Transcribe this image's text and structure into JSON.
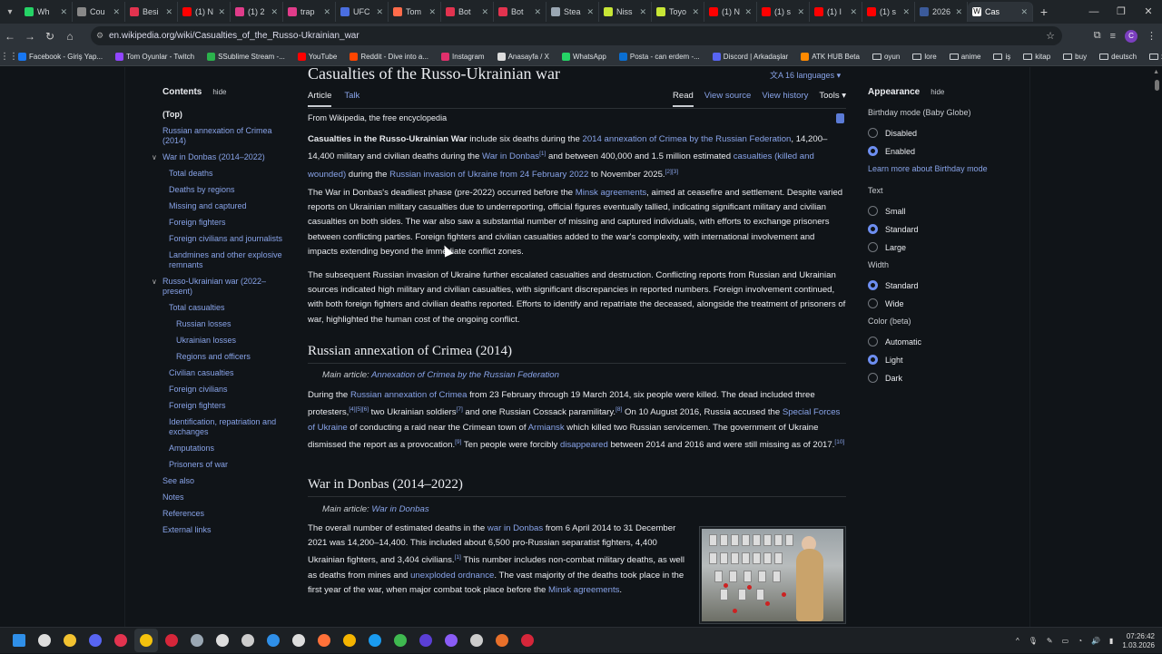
{
  "browser": {
    "tabs": [
      {
        "title": "Wh",
        "color": "#25d366"
      },
      {
        "title": "Cou",
        "color": "#888888"
      },
      {
        "title": "Besi",
        "color": "#e2334f"
      },
      {
        "title": "(1) N",
        "color": "#ff0000"
      },
      {
        "title": "(1) 2",
        "color": "#e03c8a"
      },
      {
        "title": "trap",
        "color": "#e03c8a"
      },
      {
        "title": "UFC",
        "color": "#4a6ee0"
      },
      {
        "title": "Tom",
        "color": "#ff6b4a"
      },
      {
        "title": "Bot",
        "color": "#e2334f"
      },
      {
        "title": "Bot",
        "color": "#e2334f"
      },
      {
        "title": "Stea",
        "color": "#9aa7b3"
      },
      {
        "title": "Niss",
        "color": "#c8e636"
      },
      {
        "title": "Toyo",
        "color": "#c8e636"
      },
      {
        "title": "(1) N",
        "color": "#ff0000"
      },
      {
        "title": "(1) s",
        "color": "#ff0000"
      },
      {
        "title": "(1) I",
        "color": "#ff0000"
      },
      {
        "title": "(1) s",
        "color": "#ff0000"
      },
      {
        "title": "2026",
        "color": "#3b5a9a"
      }
    ],
    "active_tab": {
      "title": "Cas",
      "icon": "wikipedia-icon"
    },
    "url": "en.wikipedia.org/wiki/Casualties_of_the_Russo-Ukrainian_war",
    "profile_initial": "C",
    "bookmarks": [
      {
        "label": "Facebook - Giriş Yap...",
        "color": "#1877f2"
      },
      {
        "label": "Tom Oyunlar - Twitch",
        "color": "#9146ff"
      },
      {
        "label": "SSublime Stream -...",
        "color": "#2bb24c"
      },
      {
        "label": "YouTube",
        "color": "#ff0000"
      },
      {
        "label": "Reddit - Dive into a...",
        "color": "#ff4500"
      },
      {
        "label": "Instagram",
        "color": "#e1306c"
      },
      {
        "label": "Anasayfa / X",
        "color": "#dddddd"
      },
      {
        "label": "WhatsApp",
        "color": "#25d366"
      },
      {
        "label": "Posta - can erdem -...",
        "color": "#0a6ed1"
      },
      {
        "label": "Discord | Arkadaşlar",
        "color": "#5865f2"
      },
      {
        "label": "ATK HUB Beta",
        "color": "#ff8a00"
      }
    ],
    "bookmark_folders": [
      "oyun",
      "lore",
      "anime",
      "iş",
      "kitap",
      "buy",
      "deutsch",
      "x"
    ]
  },
  "toc": {
    "title": "Contents",
    "hide": "hide",
    "items": [
      {
        "label": "(Top)",
        "level": "top"
      },
      {
        "label": "Russian annexation of Crimea (2014)",
        "level": 1
      },
      {
        "label": "War in Donbas (2014–2022)",
        "level": 1,
        "expanded": true
      },
      {
        "label": "Total deaths",
        "level": 2
      },
      {
        "label": "Deaths by regions",
        "level": 2
      },
      {
        "label": "Missing and captured",
        "level": 2
      },
      {
        "label": "Foreign fighters",
        "level": 2
      },
      {
        "label": "Foreign civilians and journalists",
        "level": 2
      },
      {
        "label": "Landmines and other explosive remnants",
        "level": 2
      },
      {
        "label": "Russo-Ukrainian war (2022–present)",
        "level": 1,
        "expanded": true
      },
      {
        "label": "Total casualties",
        "level": 2
      },
      {
        "label": "Russian losses",
        "level": 3
      },
      {
        "label": "Ukrainian losses",
        "level": 3
      },
      {
        "label": "Regions and officers",
        "level": 3
      },
      {
        "label": "Civilian casualties",
        "level": 2
      },
      {
        "label": "Foreign civilians",
        "level": 2
      },
      {
        "label": "Foreign fighters",
        "level": 2
      },
      {
        "label": "Identification, repatriation and exchanges",
        "level": 2
      },
      {
        "label": "Amputations",
        "level": 2
      },
      {
        "label": "Prisoners of war",
        "level": 2
      },
      {
        "label": "See also",
        "level": 1
      },
      {
        "label": "Notes",
        "level": 1
      },
      {
        "label": "References",
        "level": 1
      },
      {
        "label": "External links",
        "level": 1
      }
    ]
  },
  "article": {
    "title": "Casualties of the Russo-Ukrainian war",
    "languages": "16 languages",
    "tab_article": "Article",
    "tab_talk": "Talk",
    "tab_read": "Read",
    "tab_source": "View source",
    "tab_history": "View history",
    "tab_tools": "Tools",
    "from": "From Wikipedia, the free encyclopedia",
    "p1": {
      "bold": "Casualties in the Russo-Ukrainian War",
      "t1": " include six deaths during the ",
      "l1": "2014 annexation of Crimea by the Russian Federation",
      "t2": ", 14,200–14,400 military and civilian deaths during the ",
      "l2": "War in Donbas",
      "s1": "[1]",
      "t3": " and between 400,000 and 1.5 million estimated ",
      "l3": "casualties (killed and wounded)",
      "t4": " during the ",
      "l4": "Russian invasion of Ukraine from 24 February 2022",
      "t5": " to November 2025.",
      "s2": "[2][3]"
    },
    "p2": {
      "t1": "The War in Donbas's deadliest phase (pre-2022) occurred before the ",
      "l1": "Minsk agreements",
      "t2": ", aimed at ceasefire and settlement. Despite varied reports on Ukrainian military casualties due to underreporting, official figures eventually tallied, indicating significant military and civilian casualties on both sides. The war also saw a substantial number of missing and captured individuals, with efforts to exchange prisoners between conflicting parties. Foreign fighters and civilian casualties added to the war's complexity, with international involvement and impacts extending beyond the immediate conflict zones."
    },
    "p3": "The subsequent Russian invasion of Ukraine further escalated casualties and destruction. Conflicting reports from Russian and Ukrainian sources indicated high military and civilian casualties, with significant discrepancies in reported numbers. Foreign involvement continued, with both foreign fighters and civilian deaths reported. Efforts to identify and repatriate the deceased, alongside the treatment of prisoners of war, highlighted the human cost of the ongoing conflict.",
    "h_crimea": "Russian annexation of Crimea (2014)",
    "hat_crimea_label": "Main article: ",
    "hat_crimea_link": "Annexation of Crimea by the Russian Federation",
    "p4": {
      "t1": "During the ",
      "l1": "Russian annexation of Crimea",
      "t2": " from 23 February through 19 March 2014, six people were killed. The dead included three protesters,",
      "s1": "[4][5][6]",
      "t3": " two Ukrainian soldiers",
      "s2": "[7]",
      "t4": " and one Russian Cossack paramilitary.",
      "s3": "[8]",
      "t5": " On 10 August 2016, Russia accused the ",
      "l2": "Special Forces of Ukraine",
      "t6": " of conducting a raid near the Crimean town of ",
      "l3": "Armiansk",
      "t7": " which killed two Russian servicemen. The government of Ukraine dismissed the report as a provocation.",
      "s4": "[9]",
      "t8": " Ten people were forcibly ",
      "l4": "disappeared",
      "t9": " between 2014 and 2016 and were still missing as of 2017.",
      "s5": "[10]"
    },
    "h_donbas": "War in Donbas (2014–2022)",
    "hat_donbas_label": "Main article: ",
    "hat_donbas_link": "War in Donbas",
    "p5": {
      "t1": "The overall number of estimated deaths in the ",
      "l1": "war in Donbas",
      "t2": " from 6 April 2014 to 31 December 2021 was 14,200–14,400. This included about 6,500 pro-Russian separatist fighters, 4,400 Ukrainian fighters, and 3,404 civilians.",
      "s1": "[1]",
      "t3": " This number includes non-combat military deaths, as well as deaths from mines and ",
      "l2": "unexploded ordnance",
      "t4": ". The vast majority of the deaths took place in the first year of the war, when major combat took place before the ",
      "l3": "Minsk agreements",
      "t5": "."
    }
  },
  "appearance": {
    "title": "Appearance",
    "hide": "hide",
    "birthday_label": "Birthday mode (Baby Globe)",
    "birthday_options": [
      {
        "label": "Disabled",
        "on": false
      },
      {
        "label": "Enabled",
        "on": true
      }
    ],
    "learn_more": "Learn more about Birthday mode",
    "text_label": "Text",
    "text_options": [
      {
        "label": "Small",
        "on": false
      },
      {
        "label": "Standard",
        "on": true
      },
      {
        "label": "Large",
        "on": false
      }
    ],
    "width_label": "Width",
    "width_options": [
      {
        "label": "Standard",
        "on": true
      },
      {
        "label": "Wide",
        "on": false
      }
    ],
    "color_label": "Color (beta)",
    "color_options": [
      {
        "label": "Automatic",
        "on": false
      },
      {
        "label": "Light",
        "on": true
      },
      {
        "label": "Dark",
        "on": false
      }
    ]
  },
  "taskbar": {
    "icons": [
      {
        "name": "windows-start-icon",
        "color": "#2f8fe8"
      },
      {
        "name": "search-icon",
        "color": "#dddddd"
      },
      {
        "name": "file-explorer-icon",
        "color": "#f2c230"
      },
      {
        "name": "discord-icon",
        "color": "#5865f2"
      },
      {
        "name": "opera-icon",
        "color": "#e2334f"
      },
      {
        "name": "chrome-icon",
        "color": "#f4c20d"
      },
      {
        "name": "app-red-icon",
        "color": "#d6263a"
      },
      {
        "name": "steam-icon",
        "color": "#9aa7b3"
      },
      {
        "name": "epic-icon",
        "color": "#dddddd"
      },
      {
        "name": "media-icon",
        "color": "#cccccc"
      },
      {
        "name": "edge-icon",
        "color": "#2f8fe8"
      },
      {
        "name": "circle-app-icon",
        "color": "#dddddd"
      },
      {
        "name": "firefox-icon",
        "color": "#ff7139"
      },
      {
        "name": "rockstar-icon",
        "color": "#f4b400"
      },
      {
        "name": "battlenet-icon",
        "color": "#1a9bf0"
      },
      {
        "name": "xbox-icon",
        "color": "#3fb950"
      },
      {
        "name": "vpn-icon",
        "color": "#5b3fd6"
      },
      {
        "name": "obs-icon",
        "color": "#8a5cf6"
      },
      {
        "name": "chatgpt-icon",
        "color": "#cccccc"
      },
      {
        "name": "terminal-icon",
        "color": "#e8702a"
      },
      {
        "name": "shield-icon",
        "color": "#d6263a"
      }
    ],
    "time": "07:26:42",
    "date": "1.03.2026"
  }
}
